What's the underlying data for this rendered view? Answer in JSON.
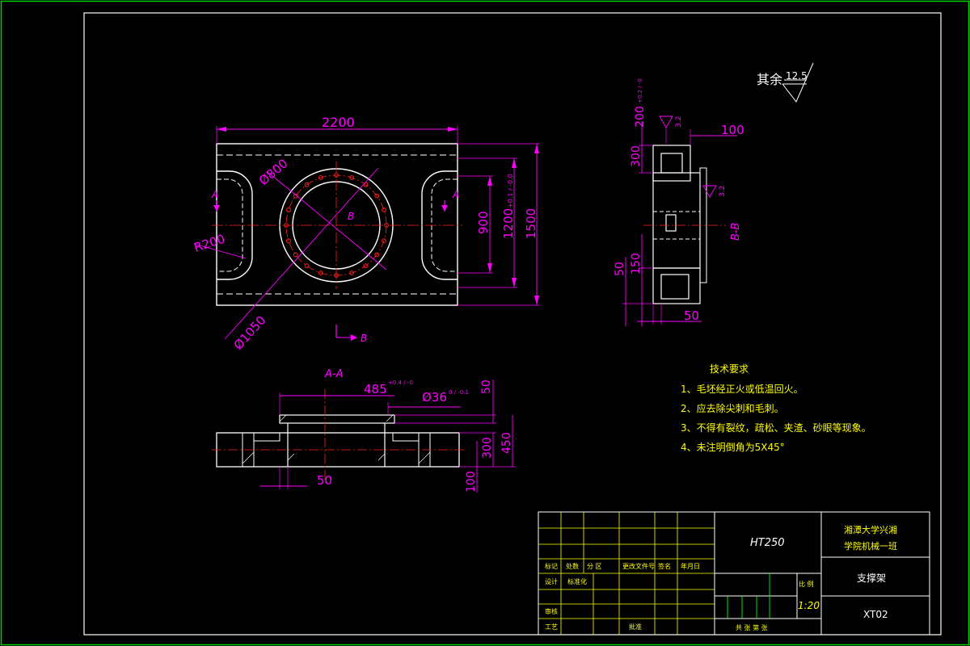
{
  "colors": {
    "background": "#000000",
    "outline": "#ffffff",
    "dimension": "#ff00ff",
    "centerline": "#ff2020",
    "text_yellow": "#ffff00",
    "title_block": "#ffff00",
    "border_green": "#00cc00"
  },
  "roughness": {
    "prefix": "其余",
    "value": "12.5"
  },
  "front_view": {
    "dim_width": "2200",
    "dim_hole_dia": "Ø800",
    "dim_radius": "R200",
    "dim_bolt_circle": "Ø1050",
    "dim_900": "900",
    "dim_1200": "1200",
    "dim_1200_tol": "+0.1 / -0.0",
    "dim_1500": "1500",
    "section_a": "A",
    "section_b": "B"
  },
  "side_view": {
    "dim_200": "200",
    "dim_200_tol": "+0.2 / -0",
    "dim_100": "100",
    "dim_300": "300",
    "rough_1": "3.2",
    "rough_2": "3.2",
    "section_label": "B-B",
    "dim_150": "150",
    "dim_50_left": "50",
    "dim_50_bottom": "50"
  },
  "section_view": {
    "title": "A-A",
    "dim_485": "485",
    "dim_485_tol": "+0.4 / -0",
    "dim_36": "Ø36",
    "dim_36_tol": "0 / -0.1",
    "dim_50_top": "50",
    "dim_450": "450",
    "dim_300": "300",
    "dim_100": "100",
    "dim_50_bottom": "50"
  },
  "tech_requirements": {
    "title": "技术要求",
    "items": [
      "1、毛坯经正火或低温回火。",
      "2、应去除尖刺和毛刺。",
      "3、不得有裂纹，疏松、夹渣、砂眼等现象。",
      "4、未注明倒角为5X45°"
    ]
  },
  "title_block": {
    "material": "HT250",
    "school_line1": "湘潭大学兴湘",
    "school_line2": "学院机械一班",
    "part_name": "支撑架",
    "drawing_no": "XT02",
    "scale_label": "比 例",
    "scale": "1:20",
    "sheet_label": "共  张  第  张",
    "headers": [
      "标记",
      "处数",
      "分  区",
      "更改文件号",
      "签名",
      "年月日"
    ],
    "row_design": "设计",
    "row_standard": "标准化",
    "row_review": "审核",
    "row_process": "工艺",
    "row_approve": "批准"
  }
}
